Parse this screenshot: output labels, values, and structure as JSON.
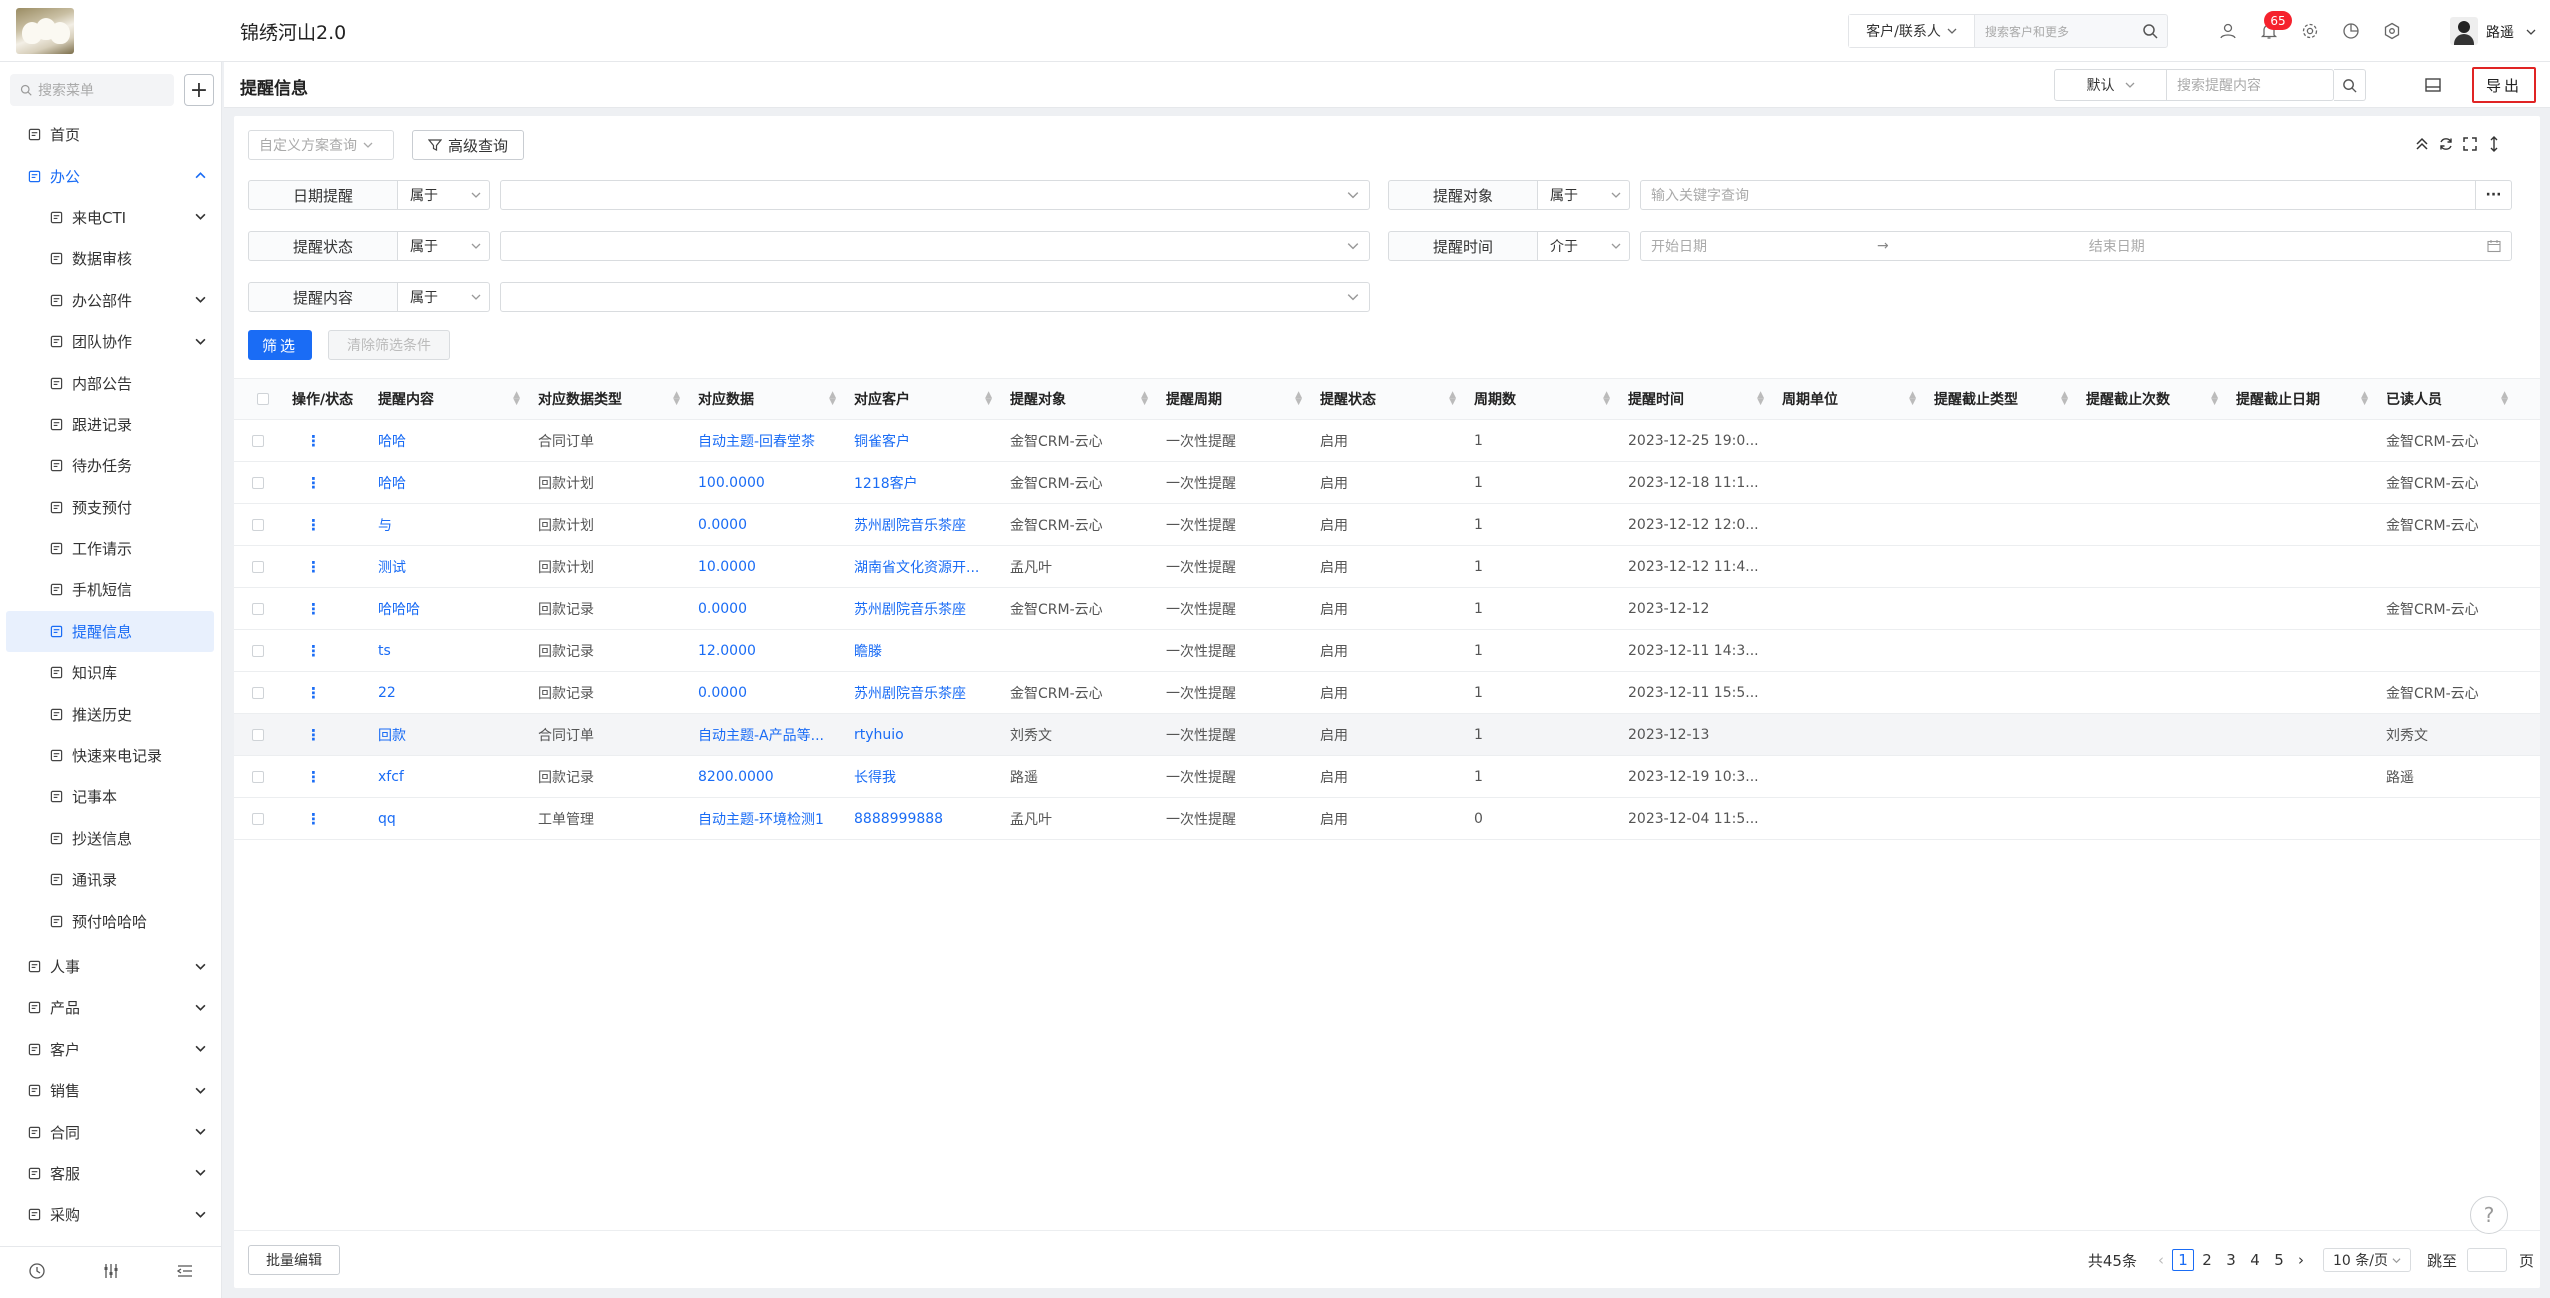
{
  "app": {
    "title": "锦绣河山2.0"
  },
  "top": {
    "search_type": "客户/联系人",
    "search_placeholder": "搜索客户和更多",
    "badge_count": "65",
    "username": "路遥"
  },
  "sidebar": {
    "search_placeholder": "搜索菜单",
    "plus": "+",
    "items": [
      {
        "label": "首页",
        "icon": "home-icon"
      },
      {
        "label": "办公",
        "icon": "office-icon"
      },
      {
        "label": "来电CTI",
        "icon": "phone-icon"
      },
      {
        "label": "数据审核",
        "icon": "user-check-icon"
      },
      {
        "label": "办公部件",
        "icon": "widget-icon"
      },
      {
        "label": "团队协作",
        "icon": "team-icon"
      },
      {
        "label": "内部公告",
        "icon": "announcement-icon"
      },
      {
        "label": "跟进记录",
        "icon": "record-icon"
      },
      {
        "label": "待办任务",
        "icon": "task-icon"
      },
      {
        "label": "预支预付",
        "icon": "prepay-icon"
      },
      {
        "label": "工作请示",
        "icon": "request-icon"
      },
      {
        "label": "手机短信",
        "icon": "sms-icon"
      },
      {
        "label": "提醒信息",
        "icon": "bell-icon"
      },
      {
        "label": "知识库",
        "icon": "knowledge-icon"
      },
      {
        "label": "推送历史",
        "icon": "push-history-icon"
      },
      {
        "label": "快速来电记录",
        "icon": "quick-call-icon"
      },
      {
        "label": "记事本",
        "icon": "notebook-icon"
      },
      {
        "label": "抄送信息",
        "icon": "cc-icon"
      },
      {
        "label": "通讯录",
        "icon": "contacts-icon"
      },
      {
        "label": "预付哈哈哈",
        "icon": "prepay2-icon"
      },
      {
        "label": "人事",
        "icon": "hr-icon"
      },
      {
        "label": "产品",
        "icon": "product-icon"
      },
      {
        "label": "客户",
        "icon": "customer-icon"
      },
      {
        "label": "销售",
        "icon": "sales-icon"
      },
      {
        "label": "合同",
        "icon": "contract-icon"
      },
      {
        "label": "客服",
        "icon": "service-icon"
      },
      {
        "label": "采购",
        "icon": "purchase-icon"
      }
    ]
  },
  "header": {
    "title": "提醒信息",
    "view_select": "默认",
    "search_placeholder": "搜索提醒内容",
    "export_label": "导出"
  },
  "toolbar": {
    "scheme_placeholder": "自定义方案查询",
    "advanced_label": "高级查询"
  },
  "filters": {
    "f1": {
      "label": "日期提醒",
      "op": "属于"
    },
    "f2": {
      "label": "提醒对象",
      "op": "属于",
      "placeholder": "输入关键字查询",
      "more": "···"
    },
    "f3": {
      "label": "提醒状态",
      "op": "属于"
    },
    "f4": {
      "label": "提醒时间",
      "op": "介于",
      "start": "开始日期",
      "arrow": "→",
      "end": "结束日期"
    },
    "f5": {
      "label": "提醒内容",
      "op": "属于"
    },
    "filter_btn": "筛选",
    "clear_btn": "清除筛选条件"
  },
  "table": {
    "columns": [
      "操作/状态",
      "提醒内容",
      "对应数据类型",
      "对应数据",
      "对应客户",
      "提醒对象",
      "提醒周期",
      "提醒状态",
      "周期数",
      "提醒时间",
      "周期单位",
      "提醒截止类型",
      "提醒截止次数",
      "提醒截止日期",
      "已读人员"
    ],
    "rows": [
      {
        "content": "哈哈",
        "type": "合同订单",
        "data": "自动主题-回春堂茶",
        "customer": "铜雀客户",
        "target": "金智CRM-云心",
        "cycle": "一次性提醒",
        "status": "启用",
        "count": "1",
        "time": "2023-12-25 19:0...",
        "unit": "",
        "end_type": "",
        "end_times": "",
        "end_date": "",
        "readers": "金智CRM-云心"
      },
      {
        "content": "哈哈",
        "type": "回款计划",
        "data": "100.0000",
        "customer": "1218客户",
        "target": "金智CRM-云心",
        "cycle": "一次性提醒",
        "status": "启用",
        "count": "1",
        "time": "2023-12-18 11:1...",
        "unit": "",
        "end_type": "",
        "end_times": "",
        "end_date": "",
        "readers": "金智CRM-云心"
      },
      {
        "content": "与",
        "type": "回款计划",
        "data": "0.0000",
        "customer": "苏州剧院音乐茶座",
        "target": "金智CRM-云心",
        "cycle": "一次性提醒",
        "status": "启用",
        "count": "1",
        "time": "2023-12-12 12:0...",
        "unit": "",
        "end_type": "",
        "end_times": "",
        "end_date": "",
        "readers": "金智CRM-云心"
      },
      {
        "content": "测试",
        "type": "回款计划",
        "data": "10.0000",
        "customer": "湖南省文化资源开...",
        "target": "孟凡叶",
        "cycle": "一次性提醒",
        "status": "启用",
        "count": "1",
        "time": "2023-12-12 11:4...",
        "unit": "",
        "end_type": "",
        "end_times": "",
        "end_date": "",
        "readers": ""
      },
      {
        "content": "哈哈哈",
        "type": "回款记录",
        "data": "0.0000",
        "customer": "苏州剧院音乐茶座",
        "target": "金智CRM-云心",
        "cycle": "一次性提醒",
        "status": "启用",
        "count": "1",
        "time": "2023-12-12",
        "unit": "",
        "end_type": "",
        "end_times": "",
        "end_date": "",
        "readers": "金智CRM-云心"
      },
      {
        "content": "ts",
        "type": "回款记录",
        "data": "12.0000",
        "customer": "瞻滕",
        "target": "",
        "cycle": "一次性提醒",
        "status": "启用",
        "count": "1",
        "time": "2023-12-11 14:3...",
        "unit": "",
        "end_type": "",
        "end_times": "",
        "end_date": "",
        "readers": ""
      },
      {
        "content": "22",
        "type": "回款记录",
        "data": "0.0000",
        "customer": "苏州剧院音乐茶座",
        "target": "金智CRM-云心",
        "cycle": "一次性提醒",
        "status": "启用",
        "count": "1",
        "time": "2023-12-11 15:5...",
        "unit": "",
        "end_type": "",
        "end_times": "",
        "end_date": "",
        "readers": "金智CRM-云心"
      },
      {
        "content": "回款",
        "type": "合同订单",
        "data": "自动主题-A产品等...",
        "customer": "rtyhuio",
        "target": "刘秀文",
        "cycle": "一次性提醒",
        "status": "启用",
        "count": "1",
        "time": "2023-12-13",
        "unit": "",
        "end_type": "",
        "end_times": "",
        "end_date": "",
        "readers": "刘秀文"
      },
      {
        "content": "xfcf",
        "type": "回款记录",
        "data": "8200.0000",
        "customer": "长得我",
        "target": "路遥",
        "cycle": "一次性提醒",
        "status": "启用",
        "count": "1",
        "time": "2023-12-19 10:3...",
        "unit": "",
        "end_type": "",
        "end_times": "",
        "end_date": "",
        "readers": "路遥"
      },
      {
        "content": "qq",
        "type": "工单管理",
        "data": "自动主题-环境检测1",
        "customer": "8888999888",
        "target": "孟凡叶",
        "cycle": "一次性提醒",
        "status": "启用",
        "count": "0",
        "time": "2023-12-04 11:5...",
        "unit": "",
        "end_type": "",
        "end_times": "",
        "end_date": "",
        "readers": ""
      }
    ]
  },
  "footer": {
    "batch_edit": "批量编辑",
    "total": "共45条",
    "pages": [
      "1",
      "2",
      "3",
      "4",
      "5"
    ],
    "page_size": "10 条/页",
    "jump_label": "跳至",
    "page_unit": "页"
  },
  "help": "?",
  "colors": {
    "accent": "#1a6cf5",
    "badge": "#f5222d",
    "export_border": "#e02424"
  }
}
